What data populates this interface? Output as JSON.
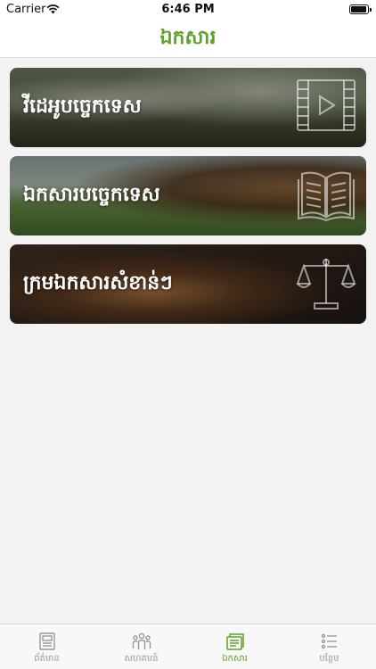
{
  "status_bar": {
    "carrier": "Carrier",
    "time": "6:46 PM"
  },
  "nav": {
    "title": "ឯកសារ"
  },
  "cards": [
    {
      "label": "វីដេអូបច្ចេកទេស",
      "icon": "video-film-icon"
    },
    {
      "label": "ឯកសារបច្ចេកទេស",
      "icon": "open-book-icon"
    },
    {
      "label": "ក្រមឯកសារសំខាន់ៗ",
      "icon": "scales-of-justice-icon"
    }
  ],
  "tabs": [
    {
      "label": "ព័ត៌មាន",
      "icon": "newspaper-icon",
      "active": false
    },
    {
      "label": "សហគមន៍",
      "icon": "people-icon",
      "active": false
    },
    {
      "label": "ឯកសារ",
      "icon": "documents-icon",
      "active": true
    },
    {
      "label": "បន្ថែម",
      "icon": "list-icon",
      "active": false
    }
  ],
  "colors": {
    "accent": "#5fa32a",
    "tab_inactive": "#999999",
    "background": "#f2f2f2"
  }
}
